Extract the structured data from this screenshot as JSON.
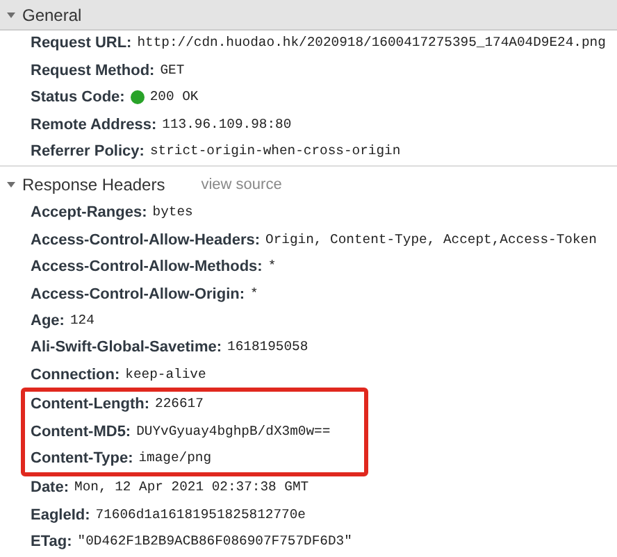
{
  "sections": [
    {
      "title": "General",
      "expanded": true,
      "rows": [
        {
          "name": "Request URL:",
          "value": "http://cdn.huodao.hk/2020918/1600417275395_174A04D9E24.png",
          "highlighted": false
        },
        {
          "name": "Request Method:",
          "value": "GET",
          "highlighted": false
        },
        {
          "name": "Status Code:",
          "value": "200 OK",
          "color": "#29a329",
          "highlighted": false
        },
        {
          "name": "Remote Address:",
          "value": "113.96.109.98:80",
          "highlighted": false
        },
        {
          "name": "Referrer Policy:",
          "value": "strict-origin-when-cross-origin",
          "highlighted": false
        }
      ]
    },
    {
      "title": "Response Headers",
      "expanded": true,
      "link": "view source",
      "rows": [
        {
          "name": "Accept-Ranges:",
          "value": "bytes",
          "highlighted": false
        },
        {
          "name": "Access-Control-Allow-Headers:",
          "value": "Origin, Content-Type, Accept,Access-Token",
          "highlighted": false
        },
        {
          "name": "Access-Control-Allow-Methods:",
          "value": "*",
          "highlighted": false
        },
        {
          "name": "Access-Control-Allow-Origin:",
          "value": "*",
          "highlighted": false
        },
        {
          "name": "Age:",
          "value": "124",
          "highlighted": false
        },
        {
          "name": "Ali-Swift-Global-Savetime:",
          "value": "1618195058",
          "highlighted": false
        },
        {
          "name": "Connection:",
          "value": "keep-alive",
          "highlighted": false
        },
        {
          "name": "Content-Length:",
          "value": "226617",
          "highlighted": true
        },
        {
          "name": "Content-MD5:",
          "value": "DUYvGyuay4bghpB/dX3m0w==",
          "highlighted": true
        },
        {
          "name": "Content-Type:",
          "value": "image/png",
          "highlighted": true
        },
        {
          "name": "Date:",
          "value": "Mon, 12 Apr 2021 02:37:38 GMT",
          "highlighted": false
        },
        {
          "name": "EagleId:",
          "value": "71606d1a16181951825812770e",
          "highlighted": false
        },
        {
          "name": "ETag:",
          "value": "\"0D462F1B2B9ACB86F086907F757DF6D3\"",
          "highlighted": false
        }
      ]
    }
  ]
}
